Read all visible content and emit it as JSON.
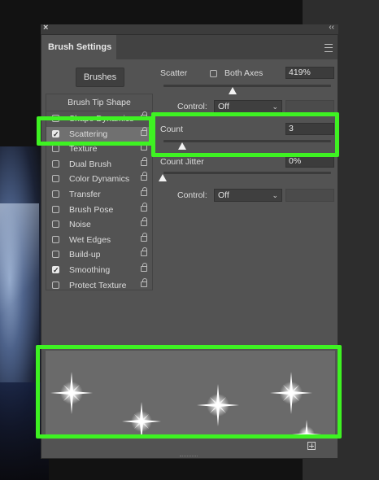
{
  "window": {
    "close_icon": "×",
    "collapse_icon": "‹‹"
  },
  "panel": {
    "title": "Brush Settings",
    "menu_icon": "hamburger-menu-icon"
  },
  "brushes_button": "Brushes",
  "list": {
    "header": "Brush Tip Shape",
    "items": [
      {
        "label": "Shape Dynamics",
        "checked": false
      },
      {
        "label": "Scattering",
        "checked": true,
        "selected": true
      },
      {
        "label": "Texture",
        "checked": false
      },
      {
        "label": "Dual Brush",
        "checked": false
      },
      {
        "label": "Color Dynamics",
        "checked": false
      },
      {
        "label": "Transfer",
        "checked": false
      },
      {
        "label": "Brush Pose",
        "checked": false
      },
      {
        "label": "Noise",
        "checked": false
      },
      {
        "label": "Wet Edges",
        "checked": false
      },
      {
        "label": "Build-up",
        "checked": false
      },
      {
        "label": "Smoothing",
        "checked": true
      },
      {
        "label": "Protect Texture",
        "checked": false
      }
    ]
  },
  "scatter": {
    "label": "Scatter",
    "both_axes_label": "Both Axes",
    "value": "419%",
    "control_label": "Control:",
    "control_value": "Off"
  },
  "count": {
    "label": "Count",
    "value": "3"
  },
  "count_jitter": {
    "label": "Count Jitter",
    "value": "0%",
    "control_label": "Control:",
    "control_value": "Off"
  },
  "colors": {
    "highlight": "#3ef222",
    "panel": "#535353"
  }
}
